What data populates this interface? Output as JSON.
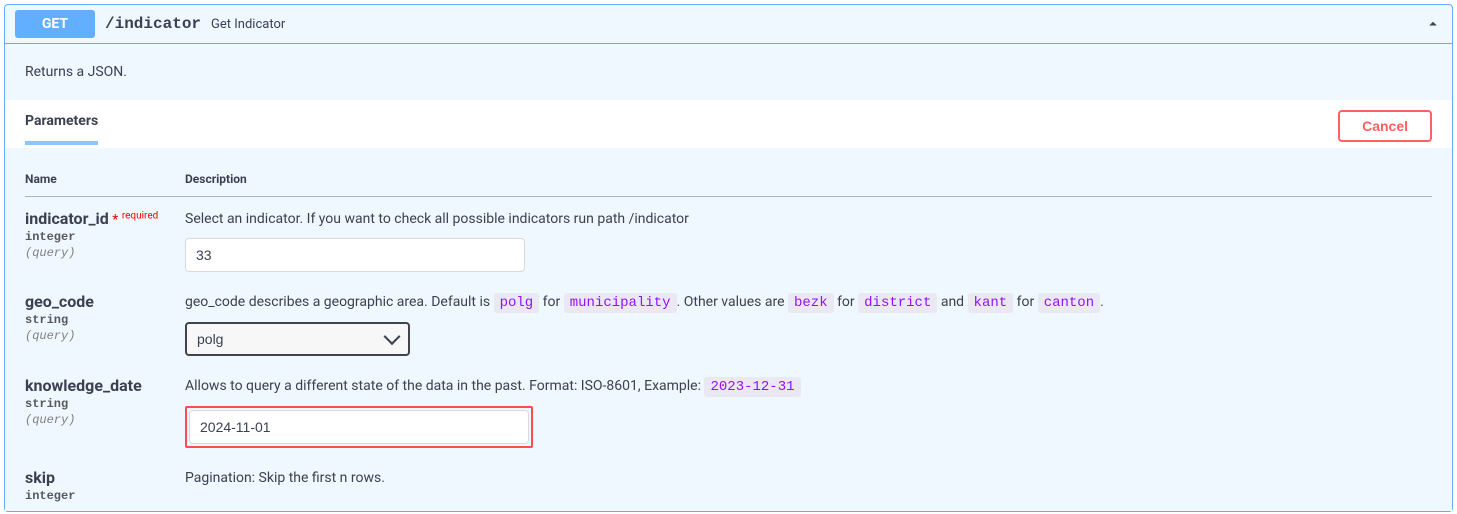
{
  "method": "GET",
  "path": "/indicator",
  "summary": "Get Indicator",
  "description": "Returns a JSON.",
  "parameters_label": "Parameters",
  "cancel_label": "Cancel",
  "columns": {
    "name": "Name",
    "description": "Description"
  },
  "params": {
    "indicator_id": {
      "name": "indicator_id",
      "required_label": "required",
      "type": "integer",
      "in": "(query)",
      "desc": "Select an indicator. If you want to check all possible indicators run path /indicator",
      "value": "33"
    },
    "geo_code": {
      "name": "geo_code",
      "type": "string",
      "in": "(query)",
      "desc_pre": "geo_code describes a geographic area. Default is ",
      "code1": "polg",
      "desc_mid1": " for ",
      "code2": "municipality",
      "desc_mid2": ". Other values are ",
      "code3": "bezk",
      "desc_mid3": " for ",
      "code4": "district",
      "desc_mid4": " and ",
      "code5": "kant",
      "desc_mid5": " for ",
      "code6": "canton",
      "desc_post": ".",
      "value": "polg"
    },
    "knowledge_date": {
      "name": "knowledge_date",
      "type": "string",
      "in": "(query)",
      "desc_pre": "Allows to query a different state of the data in the past. Format: ISO-8601, Example: ",
      "code1": "2023-12-31",
      "value": "2024-11-01"
    },
    "skip": {
      "name": "skip",
      "type": "integer",
      "desc": "Pagination: Skip the first n rows."
    }
  }
}
